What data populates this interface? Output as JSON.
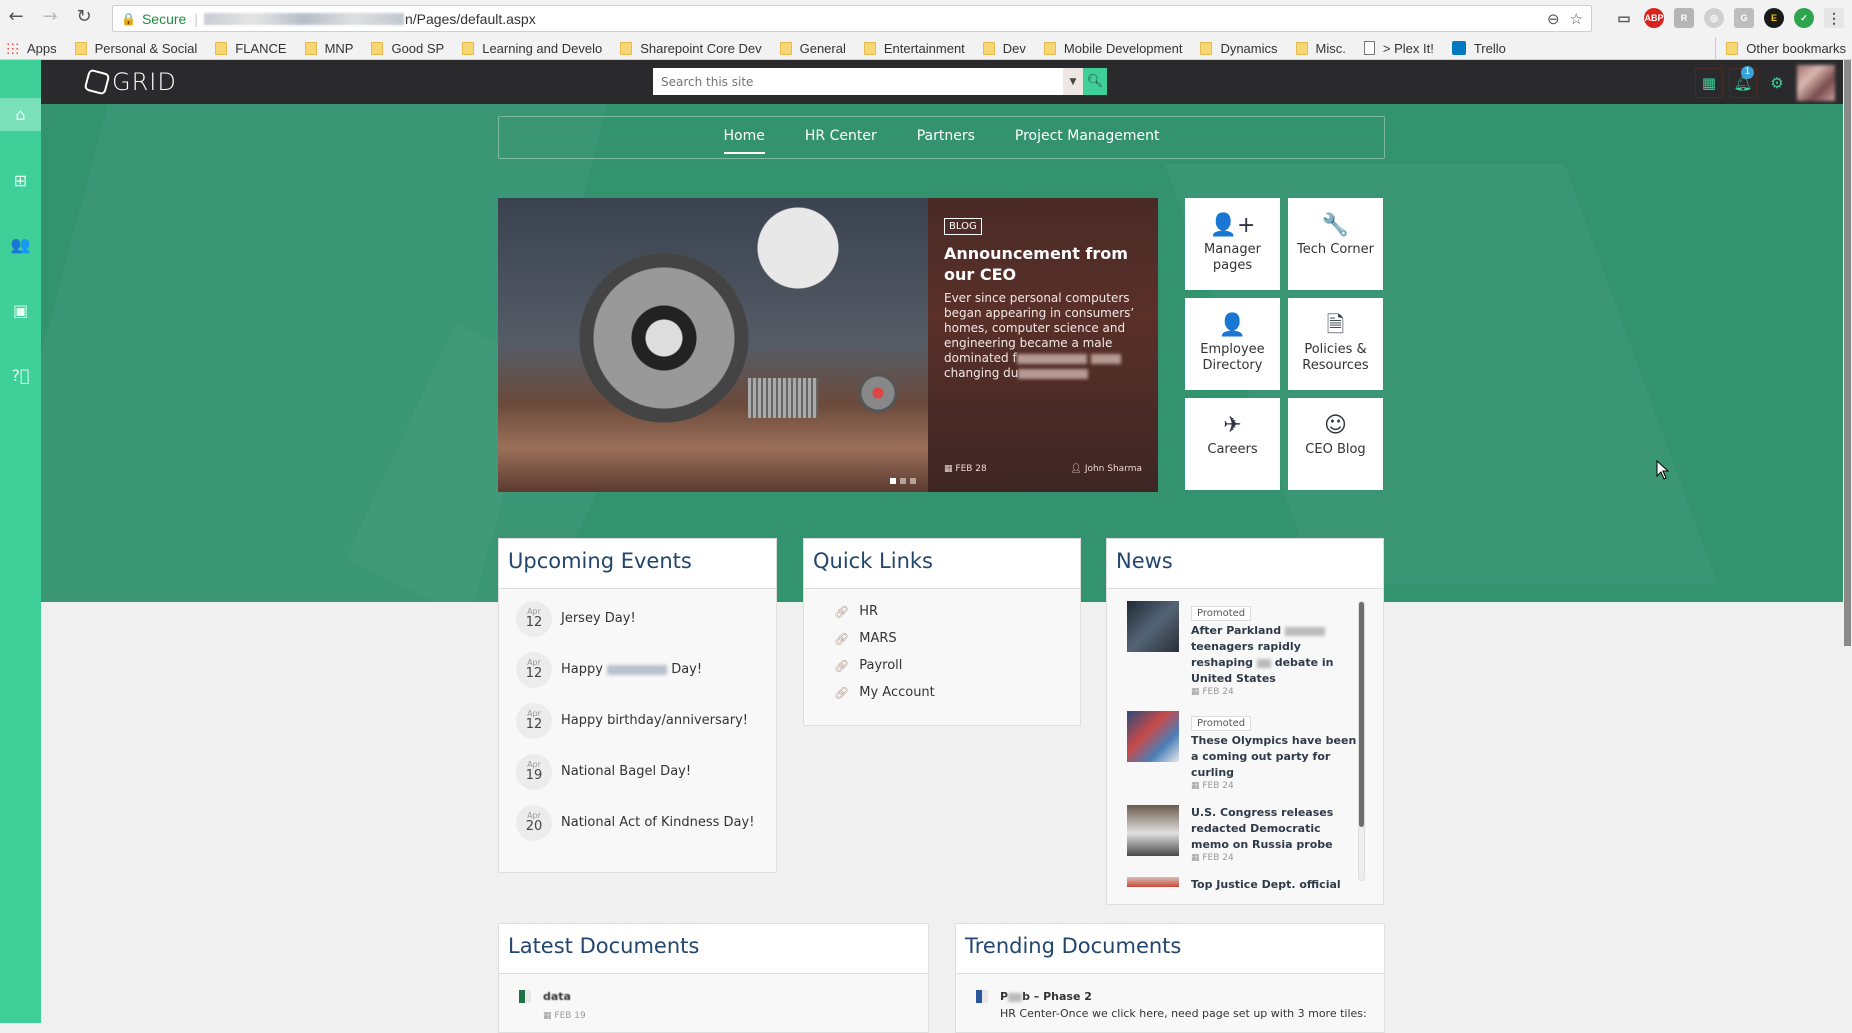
{
  "browser": {
    "secure_label": "Secure",
    "url_suffix": "n/Pages/default.aspx",
    "bookmarks": [
      {
        "label": "Apps",
        "type": "apps"
      },
      {
        "label": "Personal & Social",
        "type": "folder"
      },
      {
        "label": "FLANCE",
        "type": "folder"
      },
      {
        "label": "MNP",
        "type": "folder"
      },
      {
        "label": "Good SP",
        "type": "folder"
      },
      {
        "label": "Learning and Develo",
        "type": "folder"
      },
      {
        "label": "Sharepoint Core Dev",
        "type": "folder"
      },
      {
        "label": "General",
        "type": "folder"
      },
      {
        "label": "Entertainment",
        "type": "folder"
      },
      {
        "label": "Dev",
        "type": "folder"
      },
      {
        "label": "Mobile Development",
        "type": "folder"
      },
      {
        "label": "Dynamics",
        "type": "folder"
      },
      {
        "label": "Misc.",
        "type": "folder"
      },
      {
        "label": "> Plex It!",
        "type": "page"
      },
      {
        "label": "Trello",
        "type": "trello"
      }
    ],
    "other_bookmarks": "Other bookmarks",
    "extensions": [
      "ABP",
      "R",
      "G",
      "E",
      "✓"
    ]
  },
  "header": {
    "logo": "GRID",
    "search_placeholder": "Search this site",
    "notification_count": "1"
  },
  "sidebar": [
    "home",
    "sitemap",
    "people",
    "image",
    "help"
  ],
  "topnav": {
    "items": [
      {
        "label": "Home",
        "active": true
      },
      {
        "label": "HR Center",
        "active": false
      },
      {
        "label": "Partners",
        "active": false
      },
      {
        "label": "Project Management",
        "active": false
      }
    ]
  },
  "carousel": {
    "tag": "BLOG",
    "title": "Announcement from our CEO",
    "excerpt": "Ever since personal computers began appearing in consumers’ homes, computer science and engineering became a male dominated f",
    "excerpt_tail": "changing du",
    "date": "FEB 28",
    "author": "John Sharma",
    "slides": 3,
    "active_slide": 1
  },
  "tiles": [
    {
      "label": "Manager pages",
      "icon": "user-plus-icon",
      "glyph": "👤+"
    },
    {
      "label": "Tech Corner",
      "icon": "wrench-icon",
      "glyph": "🔧"
    },
    {
      "label": "Employee Directory",
      "icon": "user-icon",
      "glyph": "👤"
    },
    {
      "label": "Policies & Resources",
      "icon": "document-icon",
      "glyph": "🗎"
    },
    {
      "label": "Careers",
      "icon": "paper-plane-icon",
      "glyph": "✈"
    },
    {
      "label": "CEO Blog",
      "icon": "ceo-avatar-icon",
      "glyph": "☺"
    }
  ],
  "events": {
    "title": "Upcoming Events",
    "items": [
      {
        "month": "Apr",
        "day": "12",
        "title": "Jersey Day!"
      },
      {
        "month": "Apr",
        "day": "12",
        "title": "Happy",
        "title_tail": "Day!"
      },
      {
        "month": "Apr",
        "day": "12",
        "title": "Happy birthday/anniversary!"
      },
      {
        "month": "Apr",
        "day": "19",
        "title": "National Bagel Day!"
      },
      {
        "month": "Apr",
        "day": "20",
        "title": "National Act of Kindness Day!"
      }
    ]
  },
  "quick_links": {
    "title": "Quick Links",
    "items": [
      "HR",
      "MARS",
      "Payroll",
      "My Account"
    ]
  },
  "news": {
    "title": "News",
    "items": [
      {
        "promoted": "Promoted",
        "headline": "After Parkland",
        "headline_rest": "teenagers rapidly reshaping",
        "headline_end": "debate in United States",
        "date": "FEB 24"
      },
      {
        "promoted": "Promoted",
        "headline": "These Olympics have been a coming out party for curling",
        "date": "FEB 24"
      },
      {
        "promoted": "",
        "headline": "U.S. Congress releases redacted Democratic memo on Russia probe",
        "date": "FEB 24"
      },
      {
        "promoted": "",
        "headline": "Top Justice Dept. official",
        "date": ""
      }
    ]
  },
  "latest_documents": {
    "title": "Latest Documents",
    "items": [
      {
        "name": "data",
        "date": "FEB 19",
        "type": "excel"
      }
    ]
  },
  "trending_documents": {
    "title": "Trending Documents",
    "items": [
      {
        "name_start": "P",
        "name_end": "b – Phase 2",
        "description": "HR Center-Once we click here, need page set up with 3 more tiles:",
        "type": "word"
      }
    ]
  },
  "colors": {
    "accent": "#3fd09a",
    "hero_bg": "#33936f",
    "header_bg": "#2a2a2c",
    "card_title": "#22466d"
  }
}
